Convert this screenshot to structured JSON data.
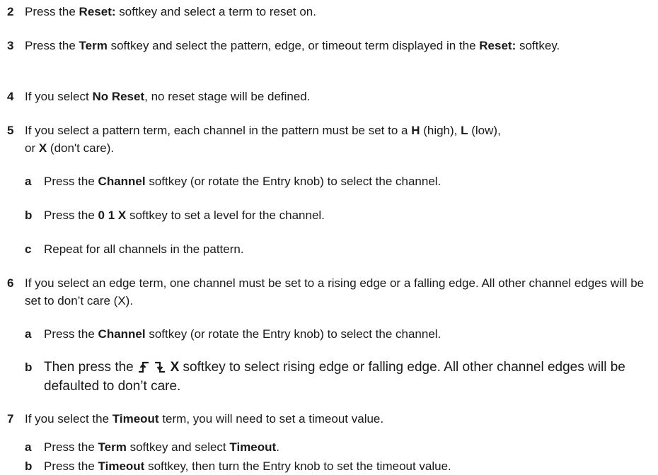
{
  "steps": [
    {
      "num": "2",
      "a": "Press the ",
      "b": "Reset:",
      "c": " softkey and select a term to reset on."
    },
    {
      "num": "3",
      "a": "Press the ",
      "b": "Term",
      "c": " softkey and select the pattern, edge, or timeout term displayed in the ",
      "d": "Reset:",
      "e": " softkey."
    },
    {
      "num": "4",
      "a": "If you select ",
      "b": "No Reset",
      "c": ", no reset stage will be defined."
    },
    {
      "num": "5",
      "a": "If you select a pattern term, each channel in the pattern must be set to a ",
      "b": "H",
      "c": " (high), ",
      "d": "L",
      "e": " (low), or ",
      "f": "X",
      "g": " (don't care).",
      "subs": [
        {
          "num": "a",
          "a": "Press the ",
          "b": "Channel",
          "c": " softkey (or rotate the Entry knob) to select the channel."
        },
        {
          "num": "b",
          "a": "Press the ",
          "b": "0 1 X",
          "c": " softkey to set a level for the channel."
        },
        {
          "num": "c",
          "a": "Repeat for all channels in the pattern."
        }
      ]
    },
    {
      "num": "6",
      "a": "If you select an edge term, one channel must be set to a rising edge or a falling edge. All other channel edges will be set to don’t care (X).",
      "subs": [
        {
          "num": "a",
          "a": "Press the ",
          "b": "Channel",
          "c": " softkey (or rotate the Entry knob) to select the channel."
        },
        {
          "num": "b",
          "a": "Then press the ",
          "b": "X",
          "c": " softkey to select rising edge or falling edge. All other channel edges will be defaulted to don’t care."
        }
      ]
    },
    {
      "num": "7",
      "a": "If you select the ",
      "b": "Timeout",
      "c": " term, you will need to set a timeout value.",
      "subs": [
        {
          "num": "a",
          "a": "Press the ",
          "b": "Term",
          "c": " softkey and select ",
          "d": "Timeout",
          "e": "."
        },
        {
          "num": "b",
          "a": "Press the ",
          "b": "Timeout",
          "c": " softkey, then turn the Entry knob to set the timeout value."
        }
      ]
    }
  ]
}
